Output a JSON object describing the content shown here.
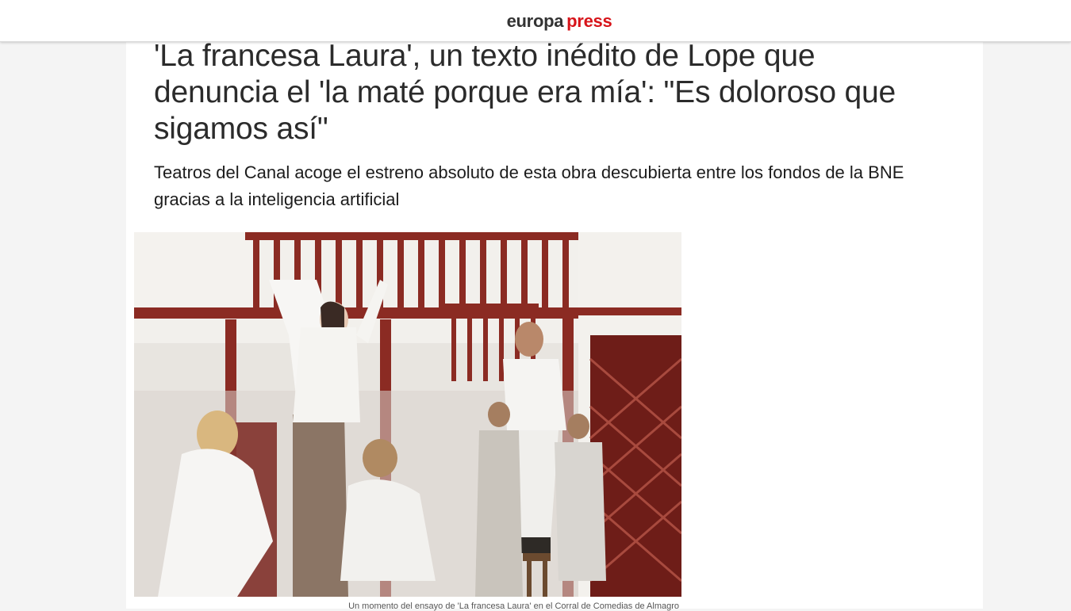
{
  "header": {
    "logo_part1": "europa",
    "logo_part2": "press"
  },
  "article": {
    "headline": "'La francesa Laura', un texto inédito de Lope que denuncia el 'la maté porque era mía': \"Es doloroso que sigamos así\"",
    "subtitle": "Teatros del Canal acoge el estreno absoluto de esta obra descubierta entre los fondos de la BNE gracias a la inteligencia artificial",
    "image_caption": "Un momento del ensayo de 'La francesa Laura' en el Corral de Comedias de Almagro"
  },
  "colors": {
    "brand_red": "#d7141a",
    "logo_dark": "#333333",
    "headline": "#2b2b2b",
    "railing_red": "#8b2b23"
  }
}
